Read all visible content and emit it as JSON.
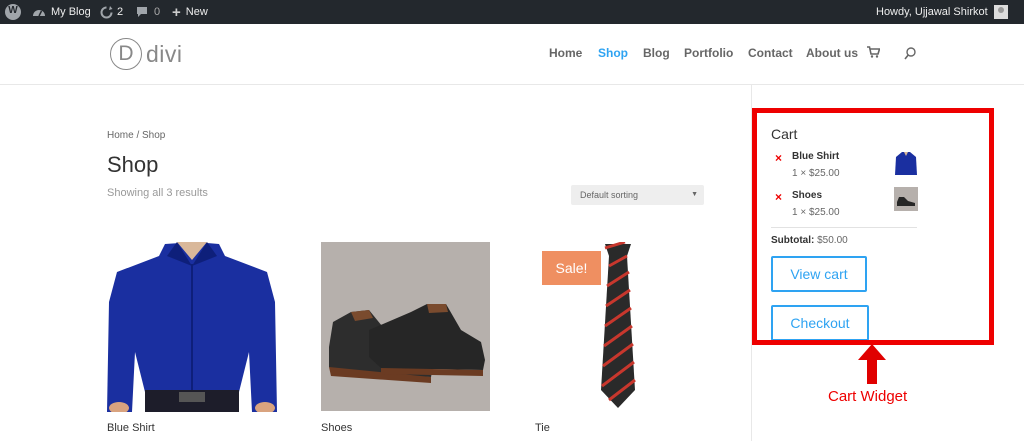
{
  "admin_bar": {
    "site_name": "My Blog",
    "updates_count": "2",
    "comments_count": "0",
    "new_label": "New",
    "greeting": "Howdy, Ujjawal Shirkot"
  },
  "header": {
    "logo_letter": "D",
    "logo_text": "divi",
    "nav": [
      {
        "label": "Home"
      },
      {
        "label": "Shop",
        "active": true
      },
      {
        "label": "Blog"
      },
      {
        "label": "Portfolio"
      },
      {
        "label": "Contact"
      },
      {
        "label": "About us"
      }
    ]
  },
  "shop": {
    "breadcrumb": "Home / Shop",
    "title": "Shop",
    "result_count": "Showing all 3 results",
    "sort_selected": "Default sorting",
    "products": [
      {
        "name": "Blue Shirt"
      },
      {
        "name": "Shoes"
      },
      {
        "name": "Tie",
        "badge": "Sale!"
      }
    ]
  },
  "cart_widget": {
    "title": "Cart",
    "items": [
      {
        "name": "Blue Shirt",
        "qty_price": "1 × $25.00"
      },
      {
        "name": "Shoes",
        "qty_price": "1 × $25.00"
      }
    ],
    "subtotal_label": "Subtotal:",
    "subtotal_value": "$50.00",
    "view_cart_label": "View cart",
    "checkout_label": "Checkout"
  },
  "annotation": {
    "label": "Cart Widget",
    "color": "#e00000"
  },
  "colors": {
    "accent": "#2ea3f2",
    "admin_bar": "#23282d",
    "sale_badge": "#ef8f61"
  }
}
